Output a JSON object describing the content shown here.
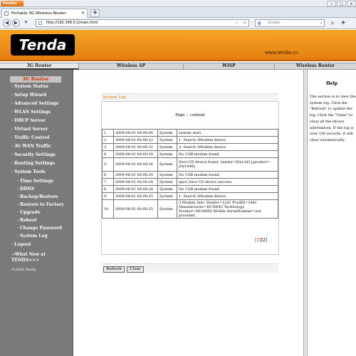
{
  "browser": {
    "app_name": "Firefox",
    "tab_title": "Portable 3G Wireless Router",
    "new_tab": "+",
    "url": "http://192.168.0.1/main.html",
    "search_placeholder": "Google",
    "minimize": "—",
    "maximize": "□",
    "close": "×",
    "tab_close": "×"
  },
  "banner": {
    "logo": "Tenda",
    "site": "www.tenda.cn"
  },
  "top_tabs": [
    "3G Router",
    "Wireless AP",
    "WISP",
    "Wireless Router"
  ],
  "sidebar": {
    "selected": "3G Router",
    "items": [
      "System Status",
      "Setup Wizard",
      "Advanced Settings",
      "WLAN Settings",
      "DHCP Server",
      "Virtual Server",
      "Traffic Control",
      "3G WAN Traffic",
      "Security Settings",
      "Routing Settings",
      "System Tools",
      "Time Settings",
      "DDNS",
      "Backup/Restore",
      "Restore to Factory",
      "Upgrade",
      "Reboot",
      "Change Password",
      "System Log",
      "Logout",
      "→What New at",
      "TENDA>>>"
    ],
    "copyright": "©2008 Tenda"
  },
  "content": {
    "section_title": "System Log",
    "page_word": "Page",
    "page_num": "1",
    "page_suffix": "content",
    "log": [
      [
        "1",
        "2009-08-01 00:00:04",
        "System",
        "system start."
      ],
      [
        "2",
        "2009-08-01 00:00:12",
        "System",
        "1. Search 3Modem device."
      ],
      [
        "3",
        "2009-08-01 00:00:12",
        "System",
        "2. Search 3Modem device."
      ],
      [
        "4",
        "2009-08-01 00:00:16",
        "System",
        "No USB modem found."
      ],
      [
        "5",
        "2009-08-01 00:00:16",
        "System",
        "Zero-CD device found, vendor=[0x12d1],product=[0x1446]."
      ],
      [
        "6",
        "2009-08-01 00:00:20",
        "System",
        "No USB modem found."
      ],
      [
        "7",
        "2009-08-01 00:00:24",
        "System",
        "eject Zero CD device success."
      ],
      [
        "8",
        "2009-08-01 00:00:24",
        "System",
        "No USB modem found."
      ],
      [
        "9",
        "2009-08-01 00:00:25",
        "System",
        "1. Search 3Modem device."
      ],
      [
        "10",
        "2009-08-01 00:00:25",
        "System",
        "3.Modem Info: Vendor=12d1 ProdID=140c Manufacturer=HUAWEI Technology Product=HUAWEI Mobile SerialNumber=not provided."
      ]
    ],
    "pager_link": "[1]",
    "pager_current": "[2]",
    "refresh": "Refresh",
    "clear": "Clear"
  },
  "help": {
    "title": "Help",
    "text": "The section is to view the system log. Click the \"Refresh\" to update the log. Click the \"Clear\" to clear all the shown information. If the log is over 150 records, it will clear automatically."
  }
}
